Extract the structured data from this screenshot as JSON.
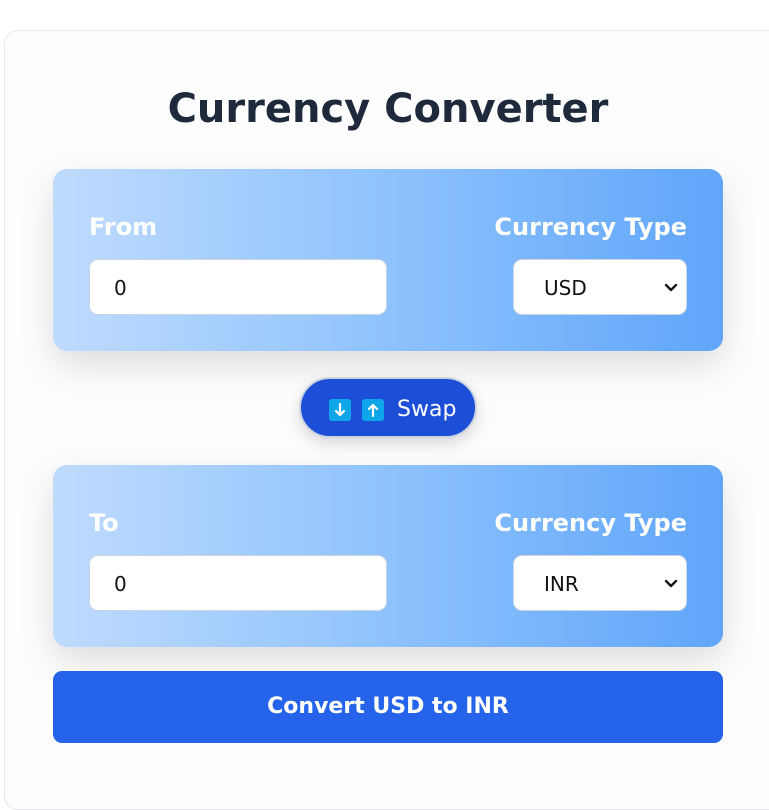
{
  "app": {
    "title": "Currency Converter"
  },
  "from_panel": {
    "label": "From",
    "amount": "0",
    "currency_label": "Currency Type",
    "currency": "USD"
  },
  "swap": {
    "label": "Swap",
    "icons": [
      "down-arrow-icon",
      "up-arrow-icon"
    ]
  },
  "to_panel": {
    "label": "To",
    "amount": "0",
    "currency_label": "Currency Type",
    "currency": "INR"
  },
  "convert": {
    "label": "Convert USD to INR"
  },
  "colors": {
    "title": "#1e293b",
    "panel_gradient_start": "#bfdbfe",
    "panel_gradient_end": "#60a5fa",
    "swap_bg": "#1d4ed8",
    "swap_icon_bg": "#0ea5e9",
    "convert_bg": "#2563eb"
  }
}
